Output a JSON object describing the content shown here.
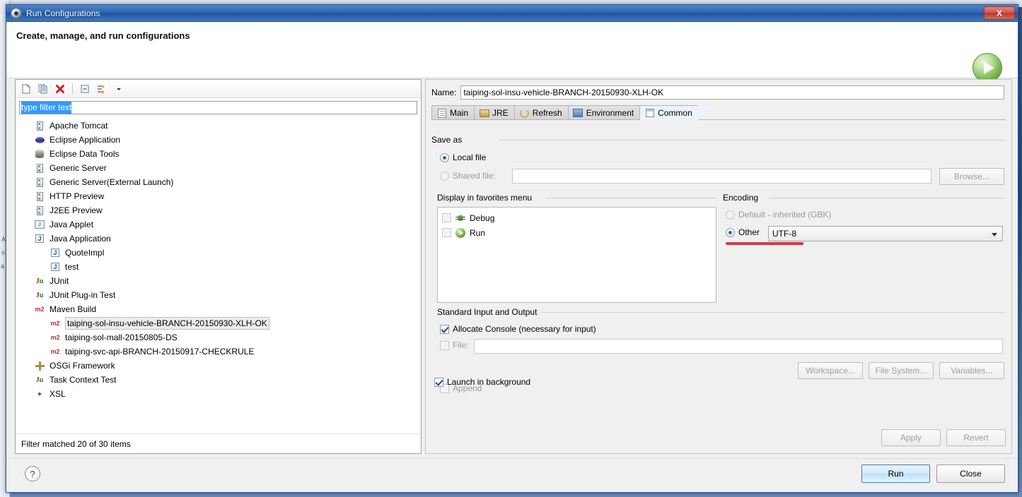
{
  "window": {
    "title": "Run Configurations",
    "icon": "eclipse-run-config-icon",
    "close_label": "X"
  },
  "header": {
    "title": "Create, manage, and run configurations",
    "big_icon": "run-green-play-icon"
  },
  "left_panel": {
    "toolbar": [
      {
        "name": "new-launch-configuration-icon",
        "label": ""
      },
      {
        "name": "duplicate-launch-configuration-icon",
        "label": ""
      },
      {
        "name": "delete-launch-configuration-icon",
        "label": ""
      },
      {
        "name": "collapse-all-icon",
        "label": ""
      },
      {
        "name": "filter-launch-configurations-icon",
        "label": ""
      },
      {
        "name": "toolbar-dropdown-arrow-icon",
        "label": ""
      }
    ],
    "filter": {
      "value": "type filter text",
      "placeholder": "type filter text",
      "selected": true
    },
    "tree": [
      {
        "label": "Apache Tomcat",
        "icon": "server-icon",
        "indent": 0,
        "selected": false
      },
      {
        "label": "Eclipse Application",
        "icon": "eclipse-icon",
        "indent": 0,
        "selected": false
      },
      {
        "label": "Eclipse Data Tools",
        "icon": "database-icon",
        "indent": 0,
        "selected": false
      },
      {
        "label": "Generic Server",
        "icon": "server-icon",
        "indent": 0,
        "selected": false
      },
      {
        "label": "Generic Server(External Launch)",
        "icon": "server-icon",
        "indent": 0,
        "selected": false
      },
      {
        "label": "HTTP Preview",
        "icon": "server-icon",
        "indent": 0,
        "selected": false
      },
      {
        "label": "J2EE Preview",
        "icon": "server-icon",
        "indent": 0,
        "selected": false
      },
      {
        "label": "Java Applet",
        "icon": "java-applet-icon",
        "indent": 0,
        "selected": false
      },
      {
        "label": "Java Application",
        "icon": "java-application-icon",
        "indent": 0,
        "selected": false
      },
      {
        "label": "QuoteImpl",
        "icon": "java-application-icon",
        "indent": 1,
        "selected": false
      },
      {
        "label": "test",
        "icon": "java-application-icon",
        "indent": 1,
        "selected": false
      },
      {
        "label": "JUnit",
        "icon": "junit-icon",
        "indent": 0,
        "selected": false
      },
      {
        "label": "JUnit Plug-in Test",
        "icon": "junit-plugin-icon",
        "indent": 0,
        "selected": false
      },
      {
        "label": "Maven Build",
        "icon": "maven-icon",
        "indent": 0,
        "selected": false
      },
      {
        "label": "taiping-sol-insu-vehicle-BRANCH-20150930-XLH-OK",
        "icon": "maven-icon",
        "indent": 1,
        "selected": true
      },
      {
        "label": "taiping-sol-mall-20150805-DS",
        "icon": "maven-icon",
        "indent": 1,
        "selected": false
      },
      {
        "label": "taiping-svc-api-BRANCH-20150917-CHECKRULE",
        "icon": "maven-icon",
        "indent": 1,
        "selected": false
      },
      {
        "label": "OSGi Framework",
        "icon": "osgi-icon",
        "indent": 0,
        "selected": false
      },
      {
        "label": "Task Context Test",
        "icon": "task-context-icon",
        "indent": 0,
        "selected": false
      },
      {
        "label": "XSL",
        "icon": "xsl-icon",
        "indent": 0,
        "selected": false
      }
    ],
    "status": "Filter matched 20 of 30 items"
  },
  "right_panel": {
    "name_label": "Name:",
    "name_value": "taiping-sol-insu-vehicle-BRANCH-20150930-XLH-OK",
    "tabs": [
      {
        "label": "Main",
        "icon": "main-tab-icon",
        "active": false
      },
      {
        "label": "JRE",
        "icon": "jre-tab-icon",
        "active": false
      },
      {
        "label": "Refresh",
        "icon": "refresh-tab-icon",
        "active": false
      },
      {
        "label": "Environment",
        "icon": "environment-tab-icon",
        "active": false
      },
      {
        "label": "Common",
        "icon": "common-tab-icon",
        "active": true
      }
    ],
    "save_as": {
      "group_title": "Save as",
      "local_file_label": "Local file",
      "local_file_selected": true,
      "shared_file_label": "Shared file:",
      "shared_file_selected": false,
      "shared_file_value": "",
      "browse_label": "Browse..."
    },
    "favorites": {
      "group_title": "Display in favorites menu",
      "items": [
        {
          "label": "Debug",
          "icon": "debug-bug-icon",
          "checked": false
        },
        {
          "label": "Run",
          "icon": "run-play-icon",
          "checked": false
        }
      ]
    },
    "encoding": {
      "group_title": "Encoding",
      "default_label": "Default - inherited (GBK)",
      "default_selected": false,
      "other_label": "Other",
      "other_selected": true,
      "other_value": "UTF-8",
      "highlight_color": "#c9404a"
    },
    "stdio": {
      "group_title": "Standard Input and Output",
      "allocate_console_label": "Allocate Console (necessary for input)",
      "allocate_console_checked": true,
      "file_label": "File:",
      "file_checked": false,
      "file_value": "",
      "buttons": [
        {
          "label": "Workspace...",
          "enabled": false
        },
        {
          "label": "File System...",
          "enabled": false
        },
        {
          "label": "Variables...",
          "enabled": false
        }
      ],
      "append_label": "Append",
      "append_checked": false,
      "append_enabled": false
    },
    "launch_in_background_label": "Launch in background",
    "launch_in_background_checked": true,
    "apply_label": "Apply",
    "apply_enabled": false,
    "revert_label": "Revert",
    "revert_enabled": false
  },
  "footer": {
    "help_label": "?",
    "run_label": "Run",
    "close_label": "Close"
  }
}
